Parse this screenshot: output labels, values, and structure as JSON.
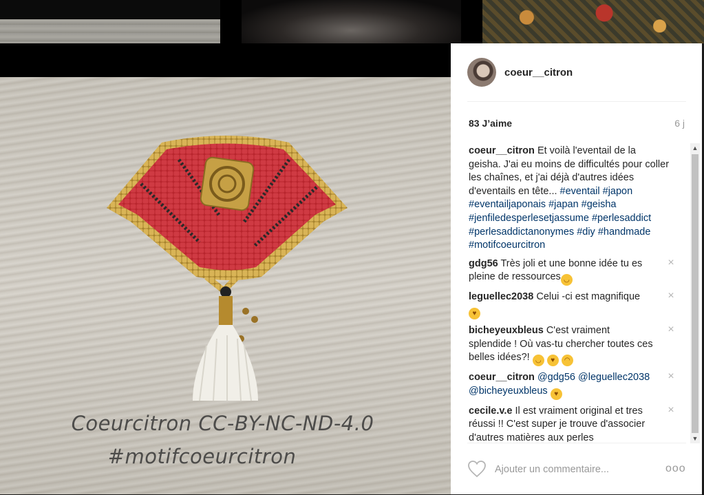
{
  "post": {
    "username": "coeur__citron",
    "likes": "83 J’aime",
    "age": "6 j",
    "watermark_line1": "Coeurcitron CC-BY-NC-ND-4.0",
    "watermark_line2": "#motifcoeurcitron"
  },
  "caption": {
    "user": "coeur__citron",
    "text": "Et voilà l'eventail de la geisha. J'ai eu moins de difficultés pour coller les chaînes, et j'ai déjà d'autres idées d'eventails en tête... ",
    "tags": [
      "#eventail",
      "#japon",
      "#eventailjaponais",
      "#japan",
      "#geisha",
      "#jenfiledesperlesetjassume",
      "#perlesaddict",
      "#perlesaddictanonymes",
      "#diy",
      "#handmade",
      "#motifcoeurcitron"
    ]
  },
  "comments": [
    {
      "user": "gdg56",
      "text": "Très joli et une bonne idée tu es pleine de ressources",
      "emojis": [
        "slight-smile"
      ]
    },
    {
      "user": "leguellec2038",
      "text": "Celui -ci est magnifique ",
      "emojis": [
        "heart-eyes"
      ]
    },
    {
      "user": "bicheyeuxbleus",
      "text": "C'est vraiment splendide ! Où vas-tu chercher toutes ces belles idées?! ",
      "emojis": [
        "grin",
        "heart-eyes",
        "smirk"
      ]
    },
    {
      "user": "coeur__citron",
      "mentions": [
        "@gdg56",
        "@leguellec2038",
        "@bicheyeuxbleus"
      ],
      "emojis": [
        "kissing-heart"
      ]
    },
    {
      "user": "cecile.v.e",
      "text": "Il est vraiment original et tres réussi !! C'est super je trouve d'associer d'autres matières aux perles"
    }
  ],
  "remove_icon": "×",
  "input": {
    "placeholder": "Ajouter un commentaire..."
  },
  "more_label": "ooo",
  "scroll": {
    "up": "▲",
    "down": "▼"
  },
  "colors": {
    "link": "#003569",
    "text": "#262626",
    "muted": "#999999"
  }
}
